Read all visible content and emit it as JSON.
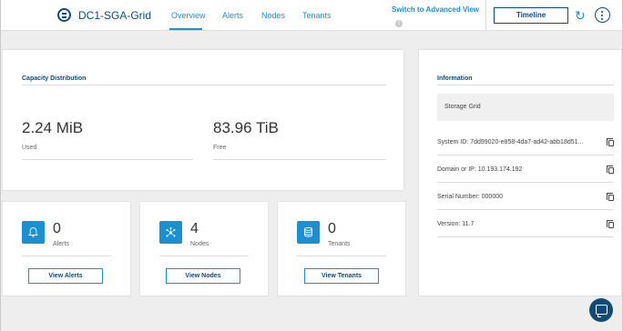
{
  "header": {
    "title": "DC1-SGA-Grid",
    "tabs": [
      {
        "label": "Overview"
      },
      {
        "label": "Alerts"
      },
      {
        "label": "Nodes"
      },
      {
        "label": "Tenants"
      }
    ],
    "switch_link": "Switch to Advanced View",
    "timeline_label": "Timeline"
  },
  "capacity": {
    "title": "Capacity Distribution",
    "used_value": "2.24 MiB",
    "used_label": "Used",
    "free_value": "83.96 TiB",
    "free_label": "Free"
  },
  "summary": [
    {
      "count": "0",
      "label": "Alerts",
      "button": "View Alerts"
    },
    {
      "count": "4",
      "label": "Nodes",
      "button": "View Nodes"
    },
    {
      "count": "0",
      "label": "Tenants",
      "button": "View Tenants"
    }
  ],
  "information": {
    "title": "Information",
    "banner": "Storage Grid",
    "rows": [
      {
        "label": "System ID:",
        "value": "7dd99020-e858-4da7-ad42-abb18d51..."
      },
      {
        "label": "Domain or IP:",
        "value": "10.193.174.192"
      },
      {
        "label": "Serial Number:",
        "value": "000000"
      },
      {
        "label": "Version:",
        "value": "11.7"
      }
    ]
  },
  "colors": {
    "brand_dark": "#0d4b78",
    "accent_blue": "#1a8fd1",
    "background": "#eeeeee"
  }
}
